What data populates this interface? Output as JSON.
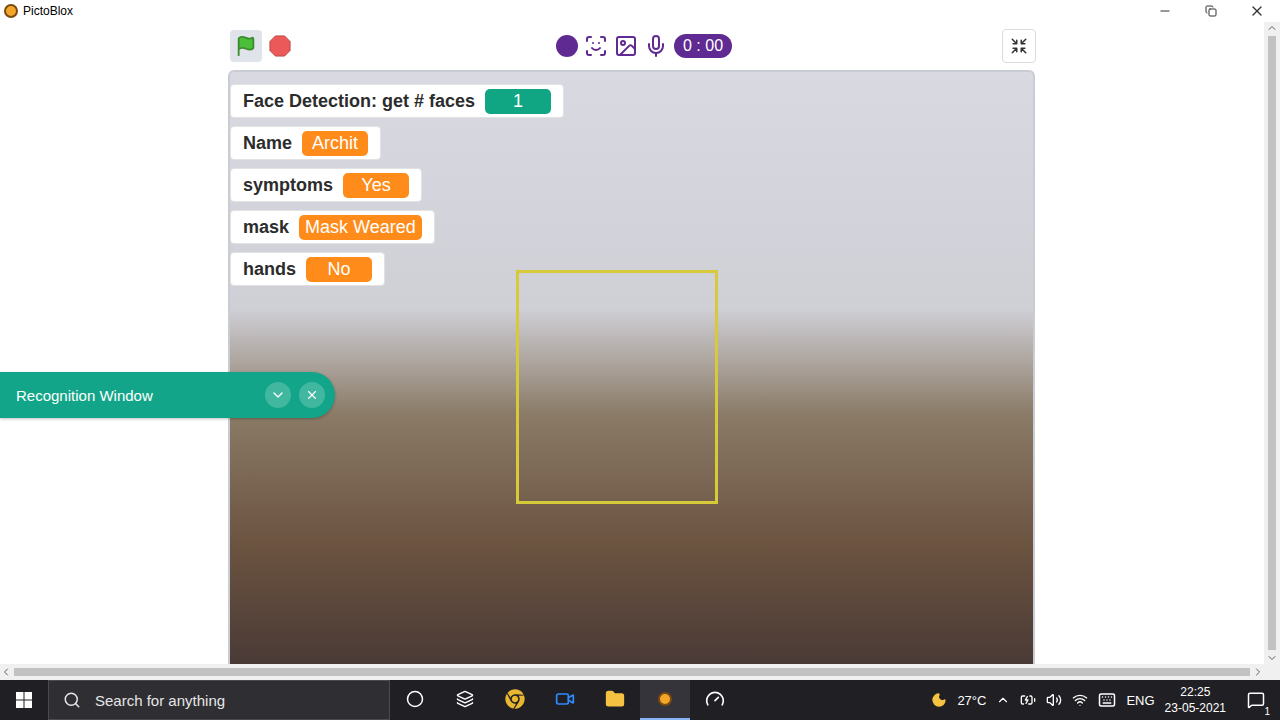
{
  "window": {
    "title": "PictoBlox"
  },
  "toolbar": {
    "timer": "0 : 00"
  },
  "stage": {
    "monitors": [
      {
        "label": "Face Detection: get # faces",
        "value": "1",
        "color": "#11a683"
      },
      {
        "label": "Name",
        "value": "Archit",
        "color": "#ff8c1a"
      },
      {
        "label": "symptoms",
        "value": "Yes",
        "color": "#ff8c1a"
      },
      {
        "label": "mask",
        "value": "Mask Weared",
        "color": "#ff8c1a"
      },
      {
        "label": "hands",
        "value": "No",
        "color": "#ff8c1a"
      }
    ]
  },
  "recognition_window": {
    "title": "Recognition Window"
  },
  "taskbar": {
    "search_placeholder": "Search for anything",
    "weather": "27°C",
    "language": "ENG",
    "time": "22:25",
    "date": "23-05-2021",
    "notifications": "1"
  }
}
